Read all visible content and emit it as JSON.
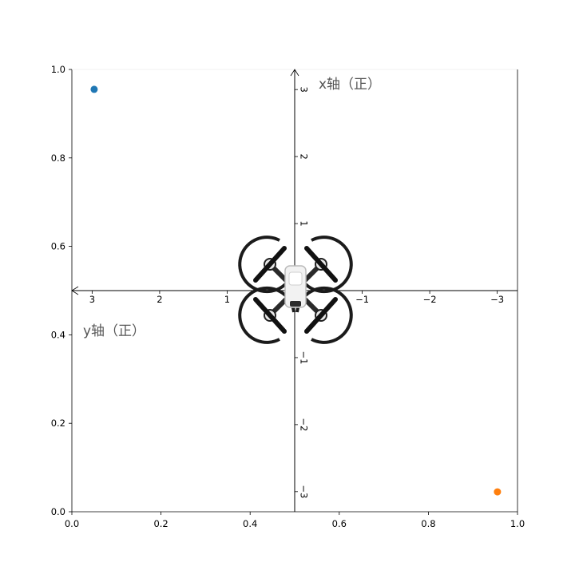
{
  "chart_data": {
    "type": "scatter",
    "xlim": [
      0,
      1
    ],
    "ylim": [
      0,
      1
    ],
    "outer_x_ticks": [
      "0.0",
      "0.2",
      "0.4",
      "0.6",
      "0.8",
      "1.0"
    ],
    "outer_y_ticks": [
      "0.0",
      "0.2",
      "0.4",
      "0.6",
      "0.8",
      "1.0"
    ],
    "grid": false,
    "points": [
      {
        "x": 0.05,
        "y": 0.955,
        "color": "#1f77b4"
      },
      {
        "x": 0.955,
        "y": 0.045,
        "color": "#ff7f0e"
      }
    ],
    "inner_axes": {
      "horizontal_range": [
        3.3,
        -3.3
      ],
      "vertical_range": [
        -3.3,
        3.3
      ],
      "horizontal_ticks": [
        "3",
        "2",
        "1",
        "−1",
        "−2",
        "−3"
      ],
      "vertical_ticks": [
        "−3",
        "−2",
        "−1",
        "1",
        "2",
        "3"
      ],
      "x_axis_label": "x轴（正）",
      "y_axis_label": "y轴（正）"
    },
    "center_icon": "quadcopter-drone-icon"
  }
}
